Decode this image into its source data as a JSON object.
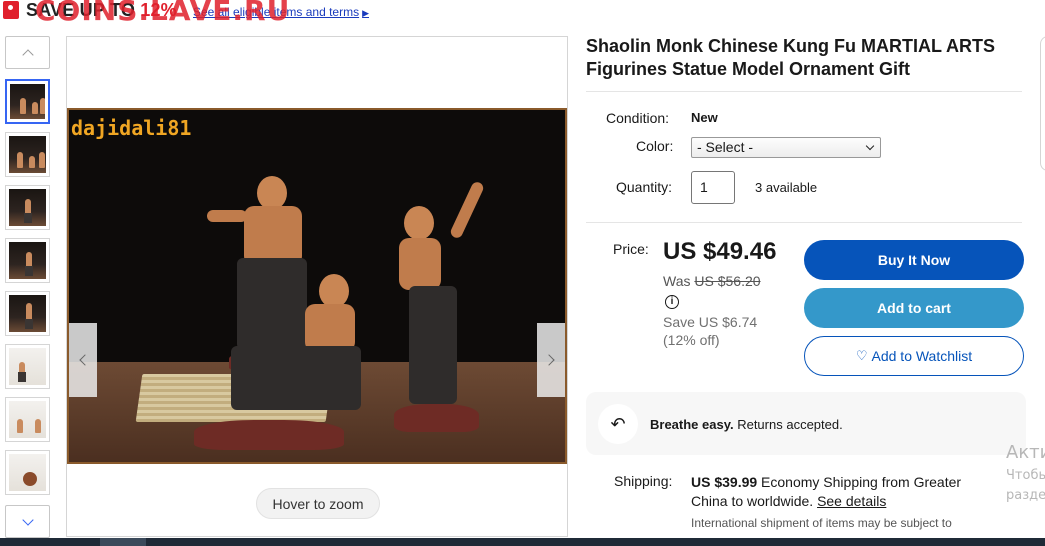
{
  "promo": {
    "save_text": "SAVE UP TO ",
    "save_pct": "12%",
    "link_text": "See all eligible items and terms",
    "watermark": "COINS.LAVE.RU"
  },
  "gallery": {
    "thumb_count": 8,
    "active_index": 0,
    "image_watermark": "dajidali81",
    "zoom_label": "Hover to zoom"
  },
  "product": {
    "title": "Shaolin Monk Chinese Kung Fu MARTIAL ARTS Figurines Statue Model Ornament Gift",
    "condition_label": "Condition:",
    "condition_value": "New",
    "color_label": "Color:",
    "color_selected": "- Select -",
    "quantity_label": "Quantity:",
    "quantity_value": "1",
    "available": "3 available"
  },
  "pricing": {
    "price_label": "Price:",
    "price": "US $49.46",
    "was_label": "Was ",
    "was_price": "US $56.20",
    "info_icon": "i",
    "save_amount": "Save US $6.74",
    "save_pct": "(12% off)"
  },
  "actions": {
    "buy_now": "Buy It Now",
    "add_to_cart": "Add to cart",
    "watchlist_heart": "♡",
    "watchlist": "Add to Watchlist"
  },
  "returns": {
    "icon": "↶",
    "bold": "Breathe easy.",
    "text": " Returns accepted."
  },
  "shipping": {
    "label": "Shipping:",
    "price": "US $39.99",
    "method": " Economy Shipping from Greater China to worldwide. ",
    "details_link": "See details",
    "note": "International shipment of items may be subject to"
  },
  "overlay": {
    "activate_1": "Акти",
    "activate_2": "Чтобы",
    "activate_3": "разде"
  },
  "colors": {
    "brand_blue": "#0654ba",
    "cart_blue": "#3498ca",
    "promo_red": "#e0202c"
  }
}
